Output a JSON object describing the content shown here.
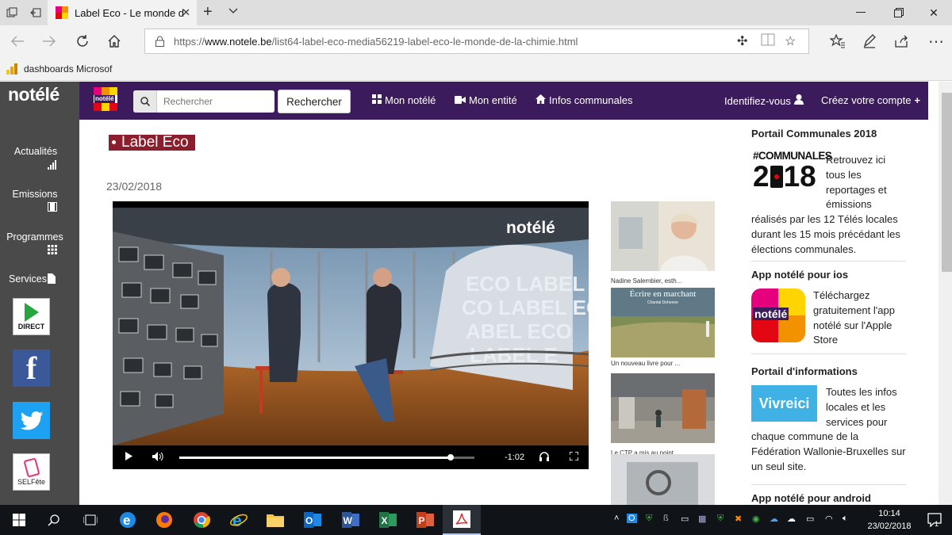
{
  "browser": {
    "tab_title": "Label Eco - Le monde d",
    "url_prefix": "https://",
    "url_host": "www.notele.be",
    "url_path": "/list64-label-eco-media56219-label-eco-le-monde-de-la-chimie.html",
    "favorite": "dashboards Microsof"
  },
  "site": {
    "logo": "notélé",
    "brand_small": "notélé",
    "search_placeholder": "Rechercher",
    "search_button": "Rechercher",
    "nav": {
      "mon_notele": "Mon notélé",
      "mon_entite": "Mon entité",
      "infos": "Infos communales",
      "login": "Identifiez-vous",
      "create": "Créez votre compte"
    },
    "sidebar": {
      "actualites": "Actualités",
      "emissions": "Emissions",
      "programmes": "Programmes",
      "services": "Services",
      "direct": "DIRECT",
      "selfete": "SELFête"
    }
  },
  "main": {
    "category": "Label Eco",
    "date": "23/02/2018",
    "video": {
      "logo": "notélé",
      "time": "-1:02",
      "progress": 0.92
    },
    "related": [
      {
        "caption": "Nadine Salembier, esth..."
      },
      {
        "caption": "Un nouveau livre pour ...",
        "img_title": "Écrire en marchant",
        "img_author": "Chantal Dehenne"
      },
      {
        "caption": "Le CTP a mis au point ..."
      },
      {
        "caption": ""
      }
    ]
  },
  "right": {
    "s1_title": "Portail Communales 2018",
    "s1_tag": "#COMMUNALES",
    "s1_year_a": "2",
    "s1_year_b": "18",
    "s1_text_a": "Retrouvez ici tous les reportages et émissions",
    "s1_text_b": "réalisés par les 12 Télés locales durant les 15 mois précédant les élections communales.",
    "s2_title": "App notélé pour ios",
    "s2_icon": "notélé",
    "s2_text": "Téléchargez gratuitement l'app notélé sur l'Apple Store",
    "s3_title": "Portail d'informations",
    "s3_icon": "Vivreici",
    "s3_text_a": "Toutes les infos locales et les services pour",
    "s3_text_b": "chaque commune de la Fédération Wallonie-Bruxelles sur un seul site.",
    "s4_title": "App notélé pour android"
  },
  "taskbar": {
    "time": "10:14",
    "date": "23/02/2018",
    "notif": "1"
  },
  "colors": {
    "nav_bg": "#3c1b5c",
    "sidebar_bg": "#4a4a4a",
    "badge_bg": "#8b1e2d"
  }
}
